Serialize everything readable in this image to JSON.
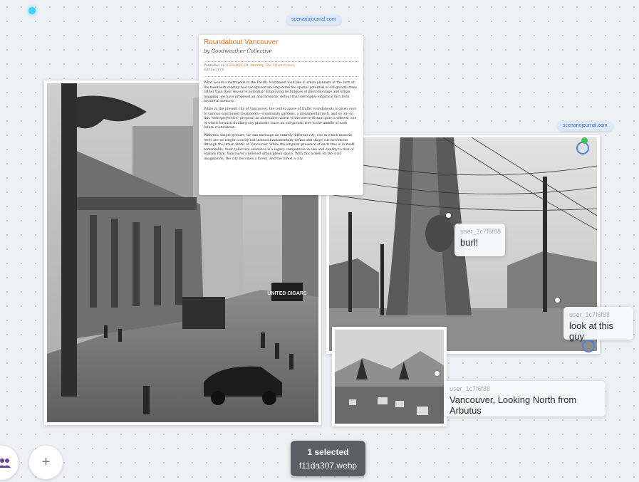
{
  "article": {
    "source": "scenariojournal.com",
    "title": "Roundabout Vancouver",
    "byline": "by Goodweather Collective",
    "published_prefix": "Published in",
    "published_link": "SCENARIO 04: Building The Urban Forest",
    "published_date": "Spring 2014",
    "paragraphs": [
      "What would a metropolis in the Pacific Northwest look like if urban planners at the turn of the twentieth century had recognized and exploited the spatial potential of old-growth trees rather than their resource potential? Employing techniques of photomontage and urban mapping, we have proposed an anachronistic detour that decouples empirical fact from historical memory.",
      "While in the present city of Vancouver, the center space of traffic roundabouts is given over to various sanctioned treatments—community gardens, a monumental rock, and so on—in this \"retroprojective\" proposal an alternative vision of the not-so-distant past is offered, one in which forward thinking city planners leave an old-growth tree in the middle of each future roundabout.",
      "With this simple gesture, we can envisage an entirely different city, one in which massive trees are no longer a rarity but instead fundamentally define and shape our movement through the urban fabric of Vancouver. While the singular presence of each tree is in itself remarkable, their collective existence is a legacy comparable in size and density to that of Stanley Park, Vancouver's beloved urban green space. With this action on the civic imagination, the city becomes a forest, and the forest a city."
    ]
  },
  "photo_street": {
    "sign_text": "UNITED CIGARS"
  },
  "photo_tree": {
    "source": "scenariojournal.com"
  },
  "comments": [
    {
      "user": "user_1c7f6f88",
      "text": "burl!"
    },
    {
      "user": "user_1c7f6f88",
      "text": "look at this guy"
    },
    {
      "user": "user_1c7f6f88",
      "text": "Vancouver, Looking North from Arbutus"
    }
  ],
  "selection": {
    "count_label": "1 selected",
    "filename": "f11da307.webp"
  },
  "toolbar": {
    "add_symbol": "+"
  },
  "colors": {
    "accent_orange": "#e8731f",
    "link_blue": "#3b73d2",
    "presence_cyan": "#3fd3f5"
  },
  "icons": {
    "people": "people-icon",
    "add": "plus-icon"
  }
}
